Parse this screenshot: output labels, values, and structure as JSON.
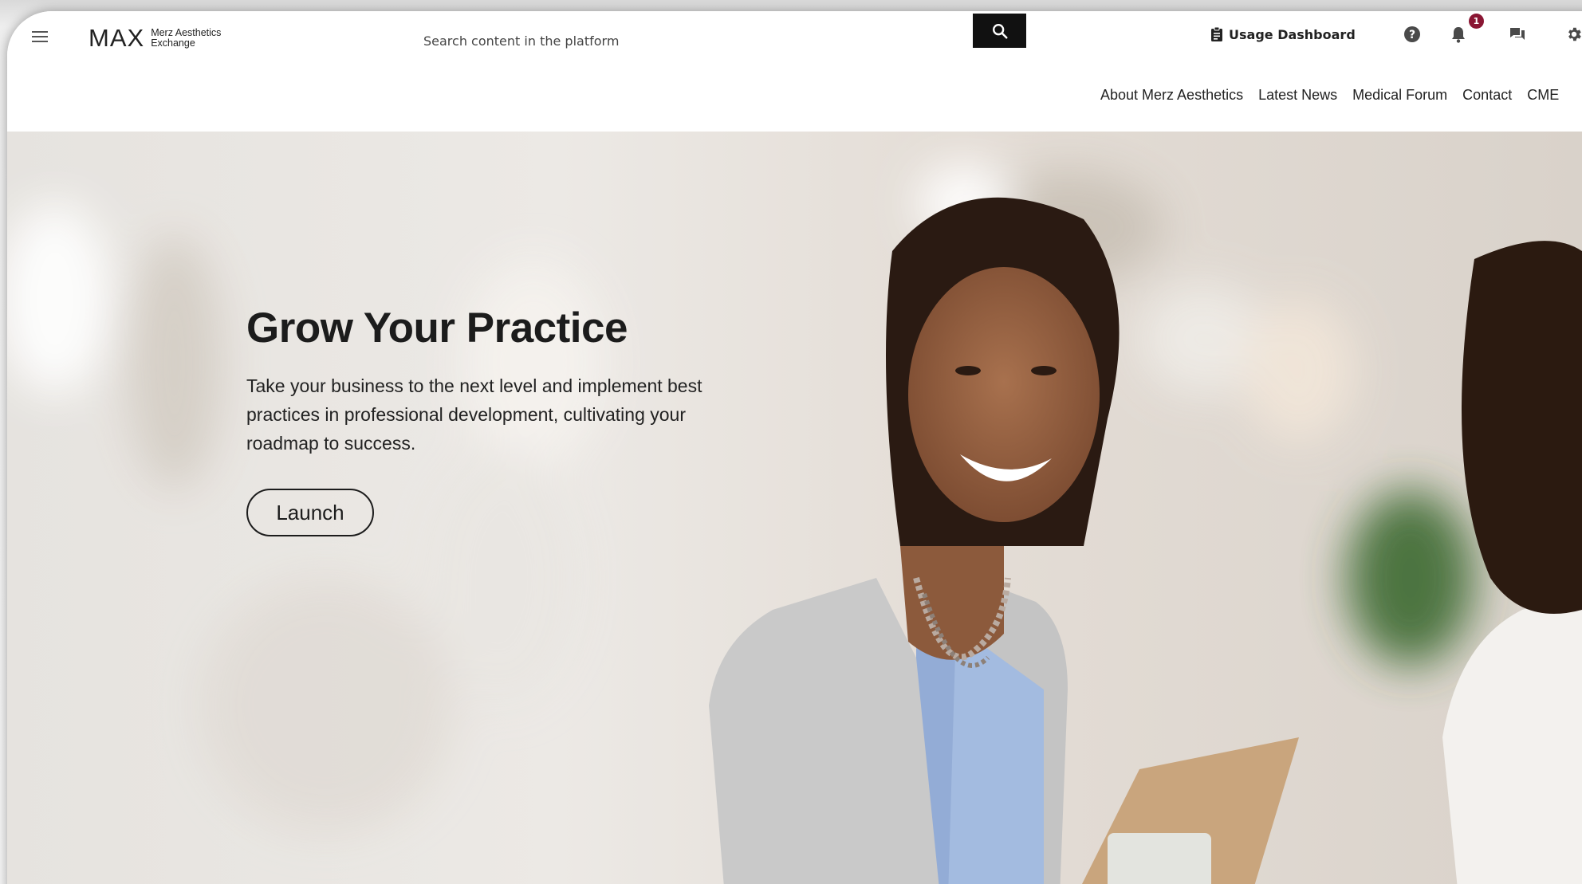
{
  "header": {
    "logo": {
      "main": "MAX",
      "line1": "Merz Aesthetics",
      "line2": "Exchange"
    },
    "search": {
      "placeholder": "Search content in the platform",
      "button_icon": "search-icon"
    },
    "usage_dashboard_label": "Usage Dashboard",
    "notification_count": "1",
    "icons": [
      "menu-icon",
      "clipboard-icon",
      "help-icon",
      "bell-icon",
      "chat-icon",
      "gear-icon"
    ]
  },
  "nav": {
    "items": [
      "About Merz Aesthetics",
      "Latest News",
      "Medical Forum",
      "Contact",
      "CME"
    ]
  },
  "hero": {
    "title": "Grow Your Practice",
    "text": "Take your business to the next level and implement best practices in professional development, cultivating your roadmap to success.",
    "button_label": "Launch"
  },
  "colors": {
    "badge": "#8a1633",
    "search_button": "#111111",
    "text_primary": "#1c1c1c"
  }
}
